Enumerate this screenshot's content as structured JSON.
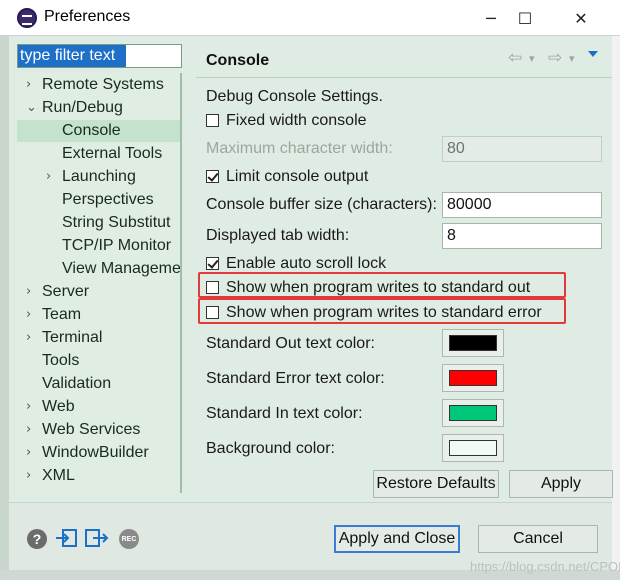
{
  "window": {
    "title": "Preferences",
    "minimize_icon": "minimize-icon",
    "maximize_icon": "maximize-icon",
    "close_icon": "close-icon"
  },
  "filter": {
    "value": "type filter text"
  },
  "tree": [
    {
      "label": "Remote Systems",
      "indent": 0,
      "arrow": "›",
      "selected": false
    },
    {
      "label": "Run/Debug",
      "indent": 0,
      "arrow": "⌄",
      "selected": false
    },
    {
      "label": "Console",
      "indent": 1,
      "arrow": "",
      "selected": true
    },
    {
      "label": "External Tools",
      "indent": 1,
      "arrow": "",
      "selected": false
    },
    {
      "label": "Launching",
      "indent": 1,
      "arrow": "›",
      "selected": false
    },
    {
      "label": "Perspectives",
      "indent": 1,
      "arrow": "",
      "selected": false
    },
    {
      "label": "String Substitut",
      "indent": 1,
      "arrow": "",
      "selected": false
    },
    {
      "label": "TCP/IP Monitor",
      "indent": 1,
      "arrow": "",
      "selected": false
    },
    {
      "label": "View Manageme",
      "indent": 1,
      "arrow": "",
      "selected": false
    },
    {
      "label": "Server",
      "indent": 0,
      "arrow": "›",
      "selected": false
    },
    {
      "label": "Team",
      "indent": 0,
      "arrow": "›",
      "selected": false
    },
    {
      "label": "Terminal",
      "indent": 0,
      "arrow": "›",
      "selected": false
    },
    {
      "label": "Tools",
      "indent": 0,
      "arrow": "",
      "selected": false
    },
    {
      "label": "Validation",
      "indent": 0,
      "arrow": "",
      "selected": false
    },
    {
      "label": "Web",
      "indent": 0,
      "arrow": "›",
      "selected": false
    },
    {
      "label": "Web Services",
      "indent": 0,
      "arrow": "›",
      "selected": false
    },
    {
      "label": "WindowBuilder",
      "indent": 0,
      "arrow": "›",
      "selected": false
    },
    {
      "label": "XML",
      "indent": 0,
      "arrow": "›",
      "selected": false
    }
  ],
  "page": {
    "title": "Console",
    "section_label": "Debug Console Settings.",
    "fixed_width": {
      "label": "Fixed width console",
      "checked": false
    },
    "max_char_width": {
      "label": "Maximum character width:",
      "value": "80"
    },
    "limit_output": {
      "label": "Limit console output",
      "checked": true
    },
    "buffer_size": {
      "label": "Console buffer size (characters):",
      "value": "80000"
    },
    "tab_width": {
      "label": "Displayed tab width:",
      "value": "8"
    },
    "auto_scroll": {
      "label": "Enable auto scroll lock",
      "checked": true
    },
    "show_out": {
      "label": "Show when program writes to standard out",
      "checked": false
    },
    "show_err": {
      "label": "Show when program writes to standard error",
      "checked": false
    },
    "out_color": {
      "label": "Standard Out text color:",
      "color": "#000000"
    },
    "err_color": {
      "label": "Standard Error text color:",
      "color": "#ff0000"
    },
    "in_color": {
      "label": "Standard In text color:",
      "color": "#00c87a"
    },
    "bg_color": {
      "label": "Background color:",
      "color": "#f2fbf5"
    },
    "restore_defaults": "Restore Defaults",
    "apply": "Apply"
  },
  "footer": {
    "apply_close": "Apply and Close",
    "cancel": "Cancel",
    "rec_label": "REC",
    "help_label": "?"
  },
  "watermark": "https://blog.csdn.net/CPOHU"
}
